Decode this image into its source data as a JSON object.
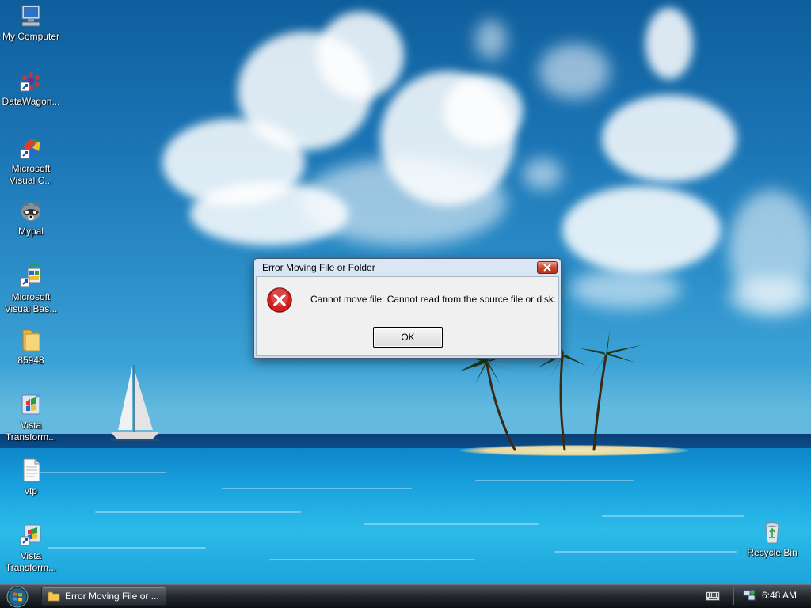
{
  "desktop_icons": [
    {
      "label": "My Computer",
      "icon": "my-computer-icon"
    },
    {
      "label": "DataWagon...",
      "icon": "datawagon-shortcut-icon"
    },
    {
      "label_line1": "Microsoft",
      "label_line2": "Visual C...",
      "icon": "visual-c-shortcut-icon"
    },
    {
      "label": "Mypal",
      "icon": "mypal-browser-icon"
    },
    {
      "label_line1": "Microsoft",
      "label_line2": "Visual Bas...",
      "icon": "visual-basic-shortcut-icon"
    },
    {
      "label": "85948",
      "icon": "folder-icon"
    },
    {
      "label_line1": "Vista",
      "label_line2": "Transform...",
      "icon": "vista-transform-icon"
    },
    {
      "label": "vtp",
      "icon": "text-file-icon"
    },
    {
      "label_line1": "Vista",
      "label_line2": "Transform...",
      "icon": "vista-transform-shortcut-icon"
    },
    {
      "label": "Recycle Bin",
      "icon": "recycle-bin-icon"
    }
  ],
  "dialog": {
    "title": "Error Moving File or Folder",
    "message": "Cannot move file: Cannot read from the source file or disk.",
    "ok_label": "OK",
    "icon": "error-icon"
  },
  "taskbar": {
    "start_icon": "windows-logo-icon",
    "task_item_label": "Error Moving File or ...",
    "clock": "6:48 AM"
  },
  "colors": {
    "error_red": "#d21f1f",
    "close_button": "#c7482c",
    "taskbar": "#262b31"
  }
}
